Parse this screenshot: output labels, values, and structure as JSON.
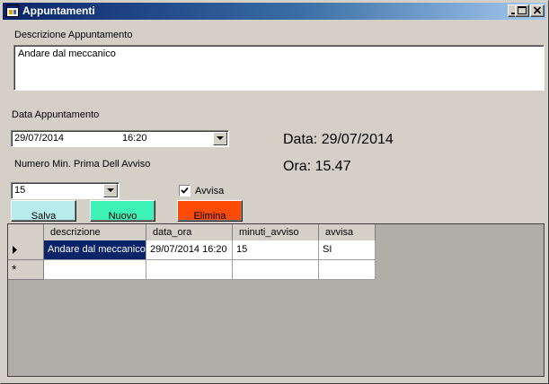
{
  "window": {
    "title": "Appuntamenti"
  },
  "form": {
    "descrizione_label": "Descrizione Appuntamento",
    "descrizione_value": "Andare dal meccanico",
    "data_label": "Data Appuntamento",
    "data_date": "29/07/2014",
    "data_time": "16:20",
    "minuti_label": "Numero Min. Prima Dell Avviso",
    "minuti_value": "15",
    "avvisa_label": "Avvisa",
    "avvisa_checked": true,
    "data_display": "Data: 29/07/2014",
    "ora_display": "Ora: 15.47"
  },
  "buttons": {
    "salva": "Salva",
    "nuovo": "Nuovo",
    "elimina": "Elimina"
  },
  "colors": {
    "salva": "#b7ecec",
    "nuovo": "#3cf2b4",
    "elimina": "#fc4b07"
  },
  "grid": {
    "columns": [
      "descrizione",
      "data_ora",
      "minuti_avviso",
      "avvisa"
    ],
    "rows": [
      [
        "Andare dal meccanico",
        "29/07/2014 16:20",
        "15",
        "SI"
      ]
    ],
    "new_row_marker": "*"
  },
  "icons": {
    "minimize": "minimize-icon",
    "maximize": "maximize-icon",
    "close": "close-icon",
    "row_pointer": "triangle-right-icon"
  }
}
